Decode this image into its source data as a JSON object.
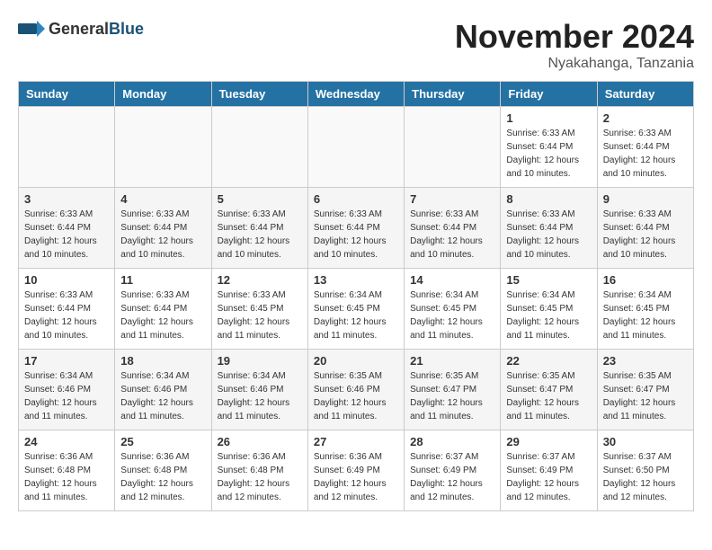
{
  "header": {
    "logo_general": "General",
    "logo_blue": "Blue",
    "month": "November 2024",
    "location": "Nyakahanga, Tanzania"
  },
  "days_of_week": [
    "Sunday",
    "Monday",
    "Tuesday",
    "Wednesday",
    "Thursday",
    "Friday",
    "Saturday"
  ],
  "weeks": [
    [
      {
        "day": "",
        "info": ""
      },
      {
        "day": "",
        "info": ""
      },
      {
        "day": "",
        "info": ""
      },
      {
        "day": "",
        "info": ""
      },
      {
        "day": "",
        "info": ""
      },
      {
        "day": "1",
        "info": "Sunrise: 6:33 AM\nSunset: 6:44 PM\nDaylight: 12 hours\nand 10 minutes."
      },
      {
        "day": "2",
        "info": "Sunrise: 6:33 AM\nSunset: 6:44 PM\nDaylight: 12 hours\nand 10 minutes."
      }
    ],
    [
      {
        "day": "3",
        "info": "Sunrise: 6:33 AM\nSunset: 6:44 PM\nDaylight: 12 hours\nand 10 minutes."
      },
      {
        "day": "4",
        "info": "Sunrise: 6:33 AM\nSunset: 6:44 PM\nDaylight: 12 hours\nand 10 minutes."
      },
      {
        "day": "5",
        "info": "Sunrise: 6:33 AM\nSunset: 6:44 PM\nDaylight: 12 hours\nand 10 minutes."
      },
      {
        "day": "6",
        "info": "Sunrise: 6:33 AM\nSunset: 6:44 PM\nDaylight: 12 hours\nand 10 minutes."
      },
      {
        "day": "7",
        "info": "Sunrise: 6:33 AM\nSunset: 6:44 PM\nDaylight: 12 hours\nand 10 minutes."
      },
      {
        "day": "8",
        "info": "Sunrise: 6:33 AM\nSunset: 6:44 PM\nDaylight: 12 hours\nand 10 minutes."
      },
      {
        "day": "9",
        "info": "Sunrise: 6:33 AM\nSunset: 6:44 PM\nDaylight: 12 hours\nand 10 minutes."
      }
    ],
    [
      {
        "day": "10",
        "info": "Sunrise: 6:33 AM\nSunset: 6:44 PM\nDaylight: 12 hours\nand 10 minutes."
      },
      {
        "day": "11",
        "info": "Sunrise: 6:33 AM\nSunset: 6:44 PM\nDaylight: 12 hours\nand 11 minutes."
      },
      {
        "day": "12",
        "info": "Sunrise: 6:33 AM\nSunset: 6:45 PM\nDaylight: 12 hours\nand 11 minutes."
      },
      {
        "day": "13",
        "info": "Sunrise: 6:34 AM\nSunset: 6:45 PM\nDaylight: 12 hours\nand 11 minutes."
      },
      {
        "day": "14",
        "info": "Sunrise: 6:34 AM\nSunset: 6:45 PM\nDaylight: 12 hours\nand 11 minutes."
      },
      {
        "day": "15",
        "info": "Sunrise: 6:34 AM\nSunset: 6:45 PM\nDaylight: 12 hours\nand 11 minutes."
      },
      {
        "day": "16",
        "info": "Sunrise: 6:34 AM\nSunset: 6:45 PM\nDaylight: 12 hours\nand 11 minutes."
      }
    ],
    [
      {
        "day": "17",
        "info": "Sunrise: 6:34 AM\nSunset: 6:46 PM\nDaylight: 12 hours\nand 11 minutes."
      },
      {
        "day": "18",
        "info": "Sunrise: 6:34 AM\nSunset: 6:46 PM\nDaylight: 12 hours\nand 11 minutes."
      },
      {
        "day": "19",
        "info": "Sunrise: 6:34 AM\nSunset: 6:46 PM\nDaylight: 12 hours\nand 11 minutes."
      },
      {
        "day": "20",
        "info": "Sunrise: 6:35 AM\nSunset: 6:46 PM\nDaylight: 12 hours\nand 11 minutes."
      },
      {
        "day": "21",
        "info": "Sunrise: 6:35 AM\nSunset: 6:47 PM\nDaylight: 12 hours\nand 11 minutes."
      },
      {
        "day": "22",
        "info": "Sunrise: 6:35 AM\nSunset: 6:47 PM\nDaylight: 12 hours\nand 11 minutes."
      },
      {
        "day": "23",
        "info": "Sunrise: 6:35 AM\nSunset: 6:47 PM\nDaylight: 12 hours\nand 11 minutes."
      }
    ],
    [
      {
        "day": "24",
        "info": "Sunrise: 6:36 AM\nSunset: 6:48 PM\nDaylight: 12 hours\nand 11 minutes."
      },
      {
        "day": "25",
        "info": "Sunrise: 6:36 AM\nSunset: 6:48 PM\nDaylight: 12 hours\nand 12 minutes."
      },
      {
        "day": "26",
        "info": "Sunrise: 6:36 AM\nSunset: 6:48 PM\nDaylight: 12 hours\nand 12 minutes."
      },
      {
        "day": "27",
        "info": "Sunrise: 6:36 AM\nSunset: 6:49 PM\nDaylight: 12 hours\nand 12 minutes."
      },
      {
        "day": "28",
        "info": "Sunrise: 6:37 AM\nSunset: 6:49 PM\nDaylight: 12 hours\nand 12 minutes."
      },
      {
        "day": "29",
        "info": "Sunrise: 6:37 AM\nSunset: 6:49 PM\nDaylight: 12 hours\nand 12 minutes."
      },
      {
        "day": "30",
        "info": "Sunrise: 6:37 AM\nSunset: 6:50 PM\nDaylight: 12 hours\nand 12 minutes."
      }
    ]
  ]
}
